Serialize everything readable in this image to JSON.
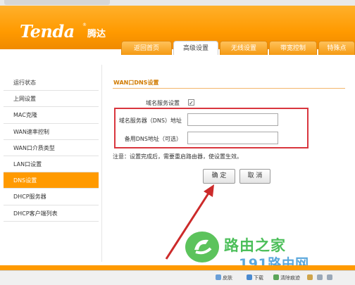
{
  "brand": {
    "logo": "Tenda",
    "reg": "®",
    "name_cn": "腾达"
  },
  "nav": {
    "tabs": [
      {
        "label": "返回首页",
        "active": false
      },
      {
        "label": "高级设置",
        "active": true
      },
      {
        "label": "无线设置",
        "active": false
      },
      {
        "label": "带宽控制",
        "active": false
      },
      {
        "label": "特殊点",
        "active": false
      }
    ]
  },
  "sidebar": {
    "items": [
      {
        "label": "运行状态",
        "active": false
      },
      {
        "label": "上网设置",
        "active": false
      },
      {
        "label": "MAC克隆",
        "active": false
      },
      {
        "label": "WAN速率控制",
        "active": false
      },
      {
        "label": "WAN口介质类型",
        "active": false
      },
      {
        "label": "LAN口设置",
        "active": false
      },
      {
        "label": "DNS设置",
        "active": true
      },
      {
        "label": "DHCP服务器",
        "active": false
      },
      {
        "label": "DHCP客户端列表",
        "active": false
      }
    ]
  },
  "main": {
    "section_title": "WAN口DNS设置",
    "dns_service_label": "域名服务设置",
    "dns_service_checked": "✓",
    "primary_dns_label": "域名服务器（DNS）地址",
    "primary_dns_value": "",
    "backup_dns_label": "备用DNS地址（可选）",
    "backup_dns_value": "",
    "note": "注意：设置完成后，需要重启路由器，使设置生效。",
    "confirm_label": "确 定",
    "cancel_label": "取 消"
  },
  "watermark": {
    "text": "路由之家",
    "url": "191路由网"
  },
  "statusbar": {
    "items": [
      "皮肤",
      "下载",
      "清除痕迹"
    ]
  },
  "colors": {
    "accent": "#ff9a00",
    "highlight": "#d9363e",
    "arrow": "#cc2a2a"
  }
}
